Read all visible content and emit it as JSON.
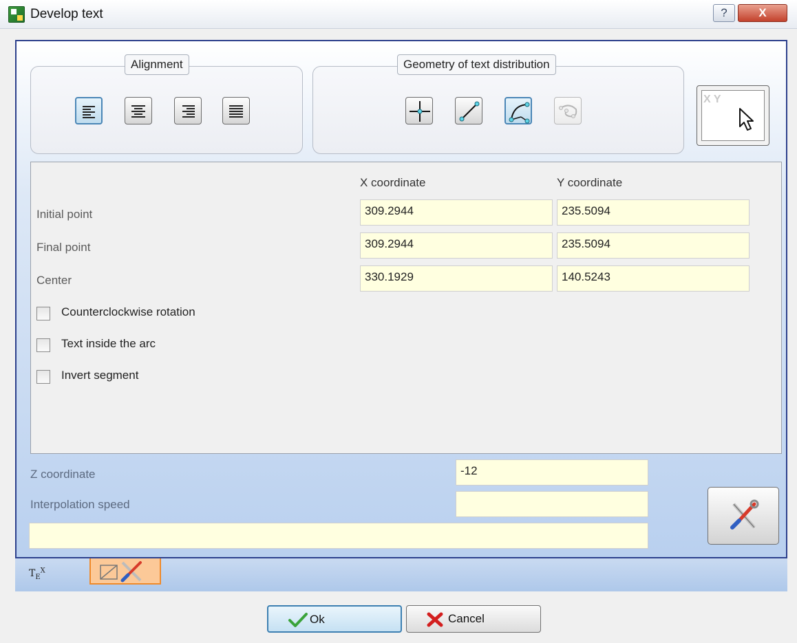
{
  "window": {
    "title": "Develop text",
    "help_glyph": "?",
    "close_glyph": "X"
  },
  "alignment": {
    "title": "Alignment",
    "buttons": [
      "align-left-icon",
      "align-center-icon",
      "align-right-icon",
      "align-justify-icon"
    ],
    "selected": "align-left-icon"
  },
  "geometry": {
    "title": "Geometry of text distribution",
    "buttons": [
      "point-icon",
      "segment-icon",
      "arc-icon",
      "free-path-icon"
    ],
    "selected": "arc-icon",
    "disabled": "free-path-icon"
  },
  "pick_button": {
    "glyph": "X Y"
  },
  "coords": {
    "x_header": "X coordinate",
    "y_header": "Y coordinate",
    "rows": [
      {
        "label": "Initial point",
        "x": "309.2944",
        "y": "235.5094"
      },
      {
        "label": "Final point",
        "x": "309.2944",
        "y": "235.5094"
      },
      {
        "label": "Center",
        "x": "330.1929",
        "y": "140.5243"
      }
    ]
  },
  "options": [
    {
      "label": "Counterclockwise rotation",
      "checked": false
    },
    {
      "label": "Text inside the arc",
      "checked": false
    },
    {
      "label": "Invert segment",
      "checked": false
    }
  ],
  "lower": {
    "z_label": "Z coordinate",
    "z_value": "-12",
    "speed_label": "Interpolation speed",
    "speed_value": "",
    "note_value": ""
  },
  "tabs": {
    "tex_label": "T",
    "tex_sub": "E",
    "tex_sup": "X"
  },
  "footer": {
    "ok_label": "Ok",
    "cancel_label": "Cancel"
  },
  "colors": {
    "accent": "#2c3f8c",
    "field_bg": "#ffffe0",
    "active_tab": "#fcc998"
  }
}
